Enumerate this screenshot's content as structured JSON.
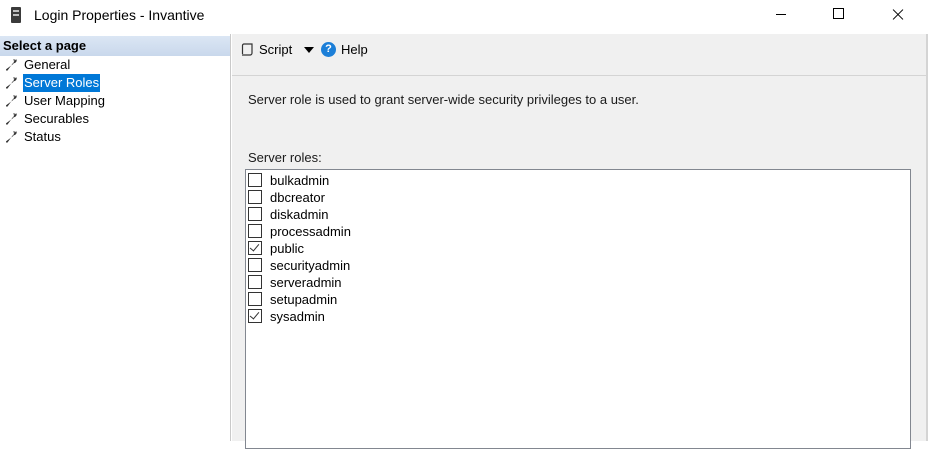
{
  "window": {
    "title": "Login Properties - Invantive",
    "icon": "server-document-icon"
  },
  "left_pane": {
    "header": "Select a page",
    "items": [
      {
        "label": "General",
        "icon": "wrench-icon",
        "selected": false
      },
      {
        "label": "Server Roles",
        "icon": "wrench-icon",
        "selected": true
      },
      {
        "label": "User Mapping",
        "icon": "wrench-icon",
        "selected": false
      },
      {
        "label": "Securables",
        "icon": "wrench-icon",
        "selected": false
      },
      {
        "label": "Status",
        "icon": "wrench-icon",
        "selected": false
      }
    ]
  },
  "toolbar": {
    "script_label": "Script",
    "help_label": "Help",
    "help_glyph": "?"
  },
  "main": {
    "description": "Server role is used to grant server-wide security privileges to a user.",
    "roles_label": "Server roles:",
    "roles": [
      {
        "name": "bulkadmin",
        "checked": false
      },
      {
        "name": "dbcreator",
        "checked": false
      },
      {
        "name": "diskadmin",
        "checked": false
      },
      {
        "name": "processadmin",
        "checked": false
      },
      {
        "name": "public",
        "checked": true
      },
      {
        "name": "securityadmin",
        "checked": false
      },
      {
        "name": "serveradmin",
        "checked": false
      },
      {
        "name": "setupadmin",
        "checked": false
      },
      {
        "name": "sysadmin",
        "checked": true
      }
    ]
  },
  "colors": {
    "selection": "#0078d7",
    "header_band": "#c9d8ec",
    "panel_bg": "#f0f0f0",
    "help_icon": "#1c7fd8"
  }
}
